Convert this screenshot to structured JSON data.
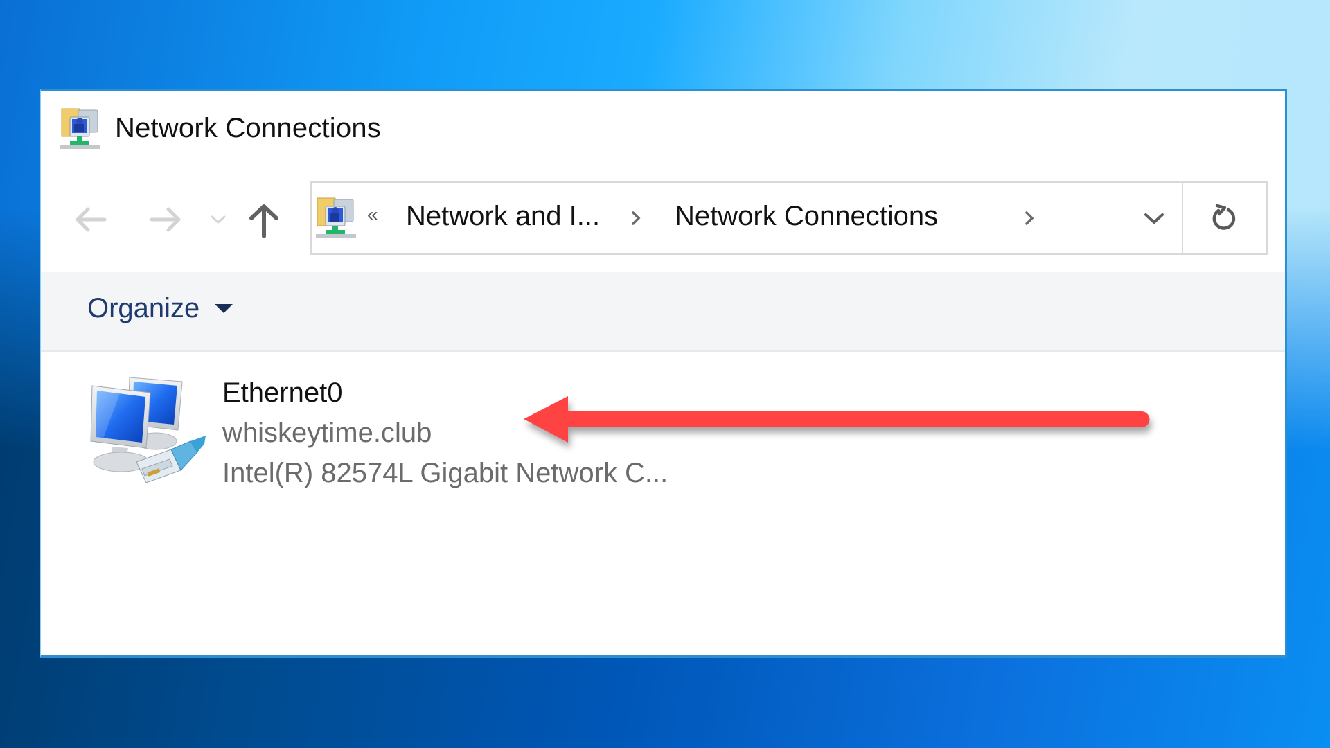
{
  "window": {
    "title": "Network Connections",
    "title_icon": "network-connections-folder-icon",
    "border_color": "#2b8fd0"
  },
  "navigation": {
    "back_icon": "arrow-left-icon",
    "forward_icon": "arrow-right-icon",
    "recent_icon": "chevron-down-small-icon",
    "up_icon": "arrow-up-icon",
    "back_enabled": false,
    "forward_enabled": false,
    "up_enabled": true
  },
  "address_bar": {
    "icon": "network-connections-folder-icon",
    "overflow_label": "«",
    "breadcrumbs": [
      {
        "label": "Network and I..."
      },
      {
        "label": "Network Connections"
      }
    ],
    "dropdown_icon": "chevron-down-icon",
    "refresh_icon": "refresh-icon"
  },
  "command_bar": {
    "organize_label": "Organize",
    "organize_caret_icon": "caret-down-icon"
  },
  "items": [
    {
      "name": "Ethernet0",
      "network": "whiskeytime.club",
      "device": "Intel(R) 82574L Gigabit Network C...",
      "icon": "network-adapter-icon"
    }
  ],
  "annotation": {
    "type": "arrow",
    "direction": "left",
    "points_to": "whiskeytime.club",
    "color": "#ff4242"
  }
}
